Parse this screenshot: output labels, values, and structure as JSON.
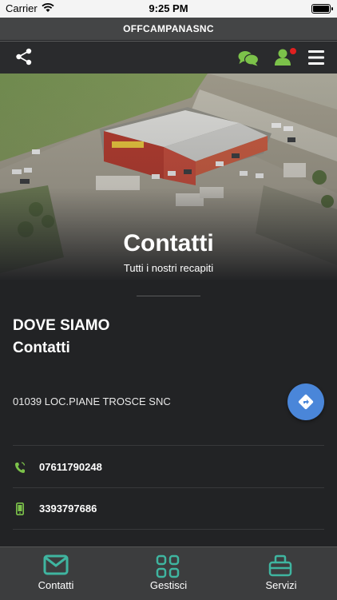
{
  "status_bar": {
    "carrier": "Carrier",
    "time": "9:25 PM"
  },
  "app": {
    "title": "OFFCAMPANASNC"
  },
  "toolbar": {
    "icons": [
      "share-icon",
      "chat-icon",
      "user-notification-icon",
      "hamburger-menu-icon"
    ],
    "accent": "#7cc24a",
    "badge_color": "#e02020"
  },
  "hero": {
    "title": "Contatti",
    "subtitle": "Tutti i nostri recapiti"
  },
  "section": {
    "heading": "DOVE SIAMO",
    "subheading": "Contatti"
  },
  "address": {
    "text": "01039 LOC.PIANE TROSCE SNC",
    "directions_icon": "directions-icon"
  },
  "contacts": [
    {
      "icon": "phone-icon",
      "value": "07611790248"
    },
    {
      "icon": "mobile-icon",
      "value": "3393797686"
    }
  ],
  "bottom_nav": {
    "items": [
      {
        "label": "Contatti",
        "icon": "mail-icon"
      },
      {
        "label": "Gestisci",
        "icon": "grid-icon"
      },
      {
        "label": "Servizi",
        "icon": "briefcase-icon"
      }
    ],
    "icon_color": "#3fb5a0"
  }
}
